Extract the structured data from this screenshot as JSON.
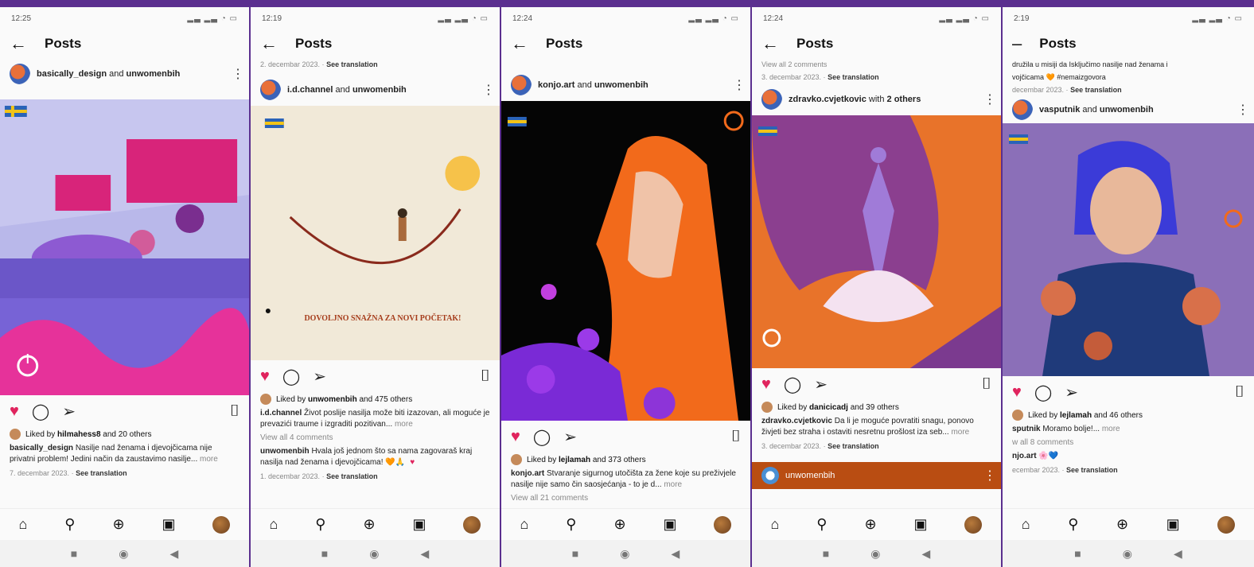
{
  "phones": [
    {
      "time": "12:25",
      "title": "Posts",
      "top_meta": "",
      "top_meta_link": "",
      "poster_main": "basically_design",
      "poster_join": "and",
      "poster_second": "unwomenbih",
      "liked_by_prefix": "Liked by",
      "liked_by_user": "hilmahess8",
      "liked_by_suffix": "and 20 others",
      "caption_user": "basically_design",
      "caption_text": "Nasilje nad ženama i djevojčicama nije privatni problem! Jedini način da zaustavimo nasilje...",
      "more": "more",
      "comments": "",
      "comment_user": "",
      "comment_text": "",
      "date": "7. decembar 2023.",
      "see_translation": "See translation"
    },
    {
      "time": "12:19",
      "title": "Posts",
      "top_meta": "2. decembar 2023. ·",
      "top_meta_link": "See translation",
      "poster_main": "i.d.channel",
      "poster_join": "and",
      "poster_second": "unwomenbih",
      "liked_by_prefix": "Liked by",
      "liked_by_user": "unwomenbih",
      "liked_by_suffix": "and 475 others",
      "caption_user": "i.d.channel",
      "caption_text": "Život poslije nasilja može biti izazovan, ali moguće je prevazići traume i izgraditi pozitivan...",
      "more": "more",
      "comments": "View all 4 comments",
      "comment_user": "unwomenbih",
      "comment_text": "Hvala još jednom što sa nama zagovaraš kraj nasilja nad ženama i djevojčicama! 🧡🙏",
      "date": "1. decembar 2023.",
      "see_translation": "See translation",
      "image_text": "DOVOLJNO SNAŽNA ZA NOVI POČETAK!"
    },
    {
      "time": "12:24",
      "title": "Posts",
      "top_meta": "",
      "top_meta_link": "",
      "poster_main": "konjo.art",
      "poster_join": "and",
      "poster_second": "unwomenbih",
      "liked_by_prefix": "Liked by",
      "liked_by_user": "lejlamah",
      "liked_by_suffix": "and 373 others",
      "caption_user": "konjo.art",
      "caption_text": "Stvaranje sigurnog utočišta za žene koje su preživjele nasilje nije samo čin saosjećanja - to je d...",
      "more": "more",
      "comments": "View all 21 comments",
      "comment_user": "",
      "comment_text": "",
      "date": "",
      "see_translation": ""
    },
    {
      "time": "12:24",
      "title": "Posts",
      "top_meta": "View all 2 comments",
      "top_meta2": "3. decembar 2023. ·",
      "top_meta_link": "See translation",
      "poster_main": "zdravko.cvjetkovic",
      "poster_join": "with",
      "poster_second": "2 others",
      "liked_by_prefix": "Liked by",
      "liked_by_user": "danicicadj",
      "liked_by_suffix": "and 39 others",
      "caption_user": "zdravko.cvjetkovic",
      "caption_text": "Da li je moguće povratiti snagu, ponovo živjeti bez straha i ostaviti nesretnu prošlost iza seb...",
      "more": "more",
      "comments": "",
      "comment_user": "",
      "comment_text": "",
      "date": "3. decembar 2023.",
      "see_translation": "See translation",
      "promo_user": "unwomenbih"
    },
    {
      "time": "2:19",
      "title": "Posts",
      "top_meta": "družila u misiji da Isključimo nasilje nad ženama i",
      "top_meta2": "vojčicama 🧡 #nemaizgovora",
      "top_meta3": "decembar 2023. ·",
      "top_meta_link": "See translation",
      "poster_main": "vasputnik",
      "poster_join": "and",
      "poster_second": "unwomenbih",
      "liked_by_prefix": "Liked by",
      "liked_by_user": "lejlamah",
      "liked_by_suffix": "and 46 others",
      "caption_user": "sputnik",
      "caption_text": "Moramo bolje!...",
      "more": "more",
      "comments": "w all 8 comments",
      "comment_user": "njo.art",
      "comment_text": "🌸💙",
      "date": "ecembar 2023.",
      "see_translation": "See translation"
    }
  ],
  "colors": {
    "frame": "#5b2f8f",
    "heart": "#e0245e",
    "promo": "#b94d12"
  },
  "icons": [
    "back-arrow-icon",
    "kebab-icon",
    "heart-icon",
    "comment-icon",
    "share-icon",
    "bookmark-icon",
    "home-icon",
    "search-icon",
    "add-icon",
    "reels-icon"
  ]
}
